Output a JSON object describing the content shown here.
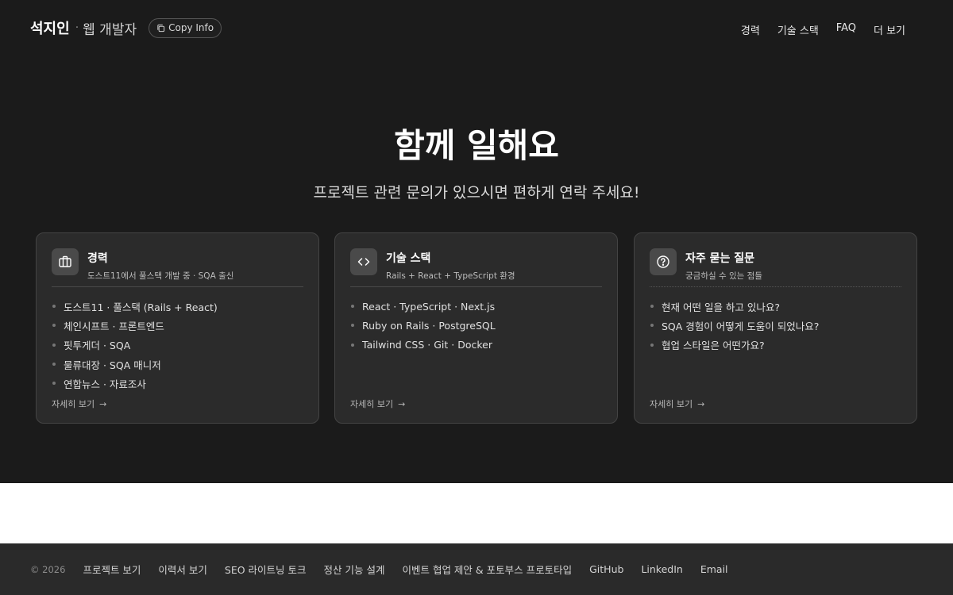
{
  "header": {
    "brand_name": "석지인",
    "brand_sep": "·",
    "brand_role": "웹 개발자",
    "copy_button": "Copy Info",
    "nav": [
      "경력",
      "기술 스택",
      "FAQ",
      "더 보기"
    ]
  },
  "hero": {
    "title": "함께 일해요",
    "subtitle": "프로젝트 관련 문의가 있으시면 편하게 연락 주세요!"
  },
  "cards": [
    {
      "icon": "briefcase-icon",
      "title": "경력",
      "subtitle": "도스트11에서 풀스택 개발 중 · SQA 출신",
      "items": [
        "도스트11 · 풀스택 (Rails + React)",
        "체인시프트 · 프론트엔드",
        "핏투게더 · SQA",
        "물류대장 · SQA 매니저",
        "연합뉴스 · 자료조사"
      ],
      "more": "자세히 보기"
    },
    {
      "icon": "code-icon",
      "title": "기술 스택",
      "subtitle": "Rails + React + TypeScript 환경",
      "items": [
        "React · TypeScript · Next.js",
        "Ruby on Rails · PostgreSQL",
        "Tailwind CSS · Git · Docker"
      ],
      "more": "자세히 보기"
    },
    {
      "icon": "question-circle-icon",
      "title": "자주 묻는 질문",
      "subtitle": "궁금하실 수 있는 점들",
      "items": [
        "현재 어떤 일을 하고 있나요?",
        "SQA 경험이 어떻게 도움이 되었나요?",
        "협업 스타일은 어떤가요?"
      ],
      "more": "자세히 보기"
    }
  ],
  "footer": {
    "copyright": "© 2026",
    "links": [
      "프로젝트 보기",
      "이력서 보기",
      "SEO 라이트닝 토크",
      "정산 기능 설계",
      "이벤트 협업 제안 & 포토부스 프로토타입",
      "GitHub",
      "LinkedIn",
      "Email"
    ]
  },
  "colors": {
    "hero_bg": "#1b1b1b",
    "card_bg": "#2b2b2b",
    "footer_bg": "#2a2a2a"
  }
}
